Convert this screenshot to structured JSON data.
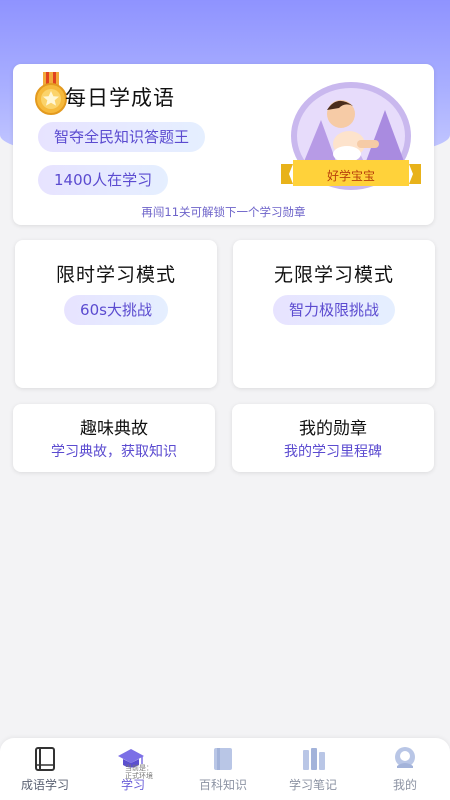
{
  "header": {
    "title": "每日学成语",
    "pill_primary": "智夺全民知识答题王",
    "pill_secondary": "1400人在学习",
    "unlock_hint": "再闯11关可解锁下一个学习勋章",
    "badge_label": "好学宝宝"
  },
  "modes": [
    {
      "title": "限时学习模式",
      "tag": "60s大挑战"
    },
    {
      "title": "无限学习模式",
      "tag": "智力极限挑战"
    }
  ],
  "features": [
    {
      "title": "趣味典故",
      "subtitle": "学习典故，获取知识"
    },
    {
      "title": "我的勋章",
      "subtitle": "我的学习里程碑"
    }
  ],
  "tabbar": {
    "items": [
      {
        "label": "成语学习",
        "icon": "book-icon"
      },
      {
        "label": "学习",
        "icon": "graduation-cap-icon"
      },
      {
        "label": "百科知识",
        "icon": "encyclopedia-icon"
      },
      {
        "label": "学习笔记",
        "icon": "notes-icon"
      },
      {
        "label": "我的",
        "icon": "profile-icon"
      }
    ],
    "active_index": 1,
    "env_note_1": "当前是：",
    "env_note_2": "正式环境"
  },
  "colors": {
    "accent": "#5b4bd0",
    "header_gradient_top": "#8f93ff",
    "header_gradient_bottom": "#c7cbff",
    "badge_ribbon": "#ffd23a"
  }
}
